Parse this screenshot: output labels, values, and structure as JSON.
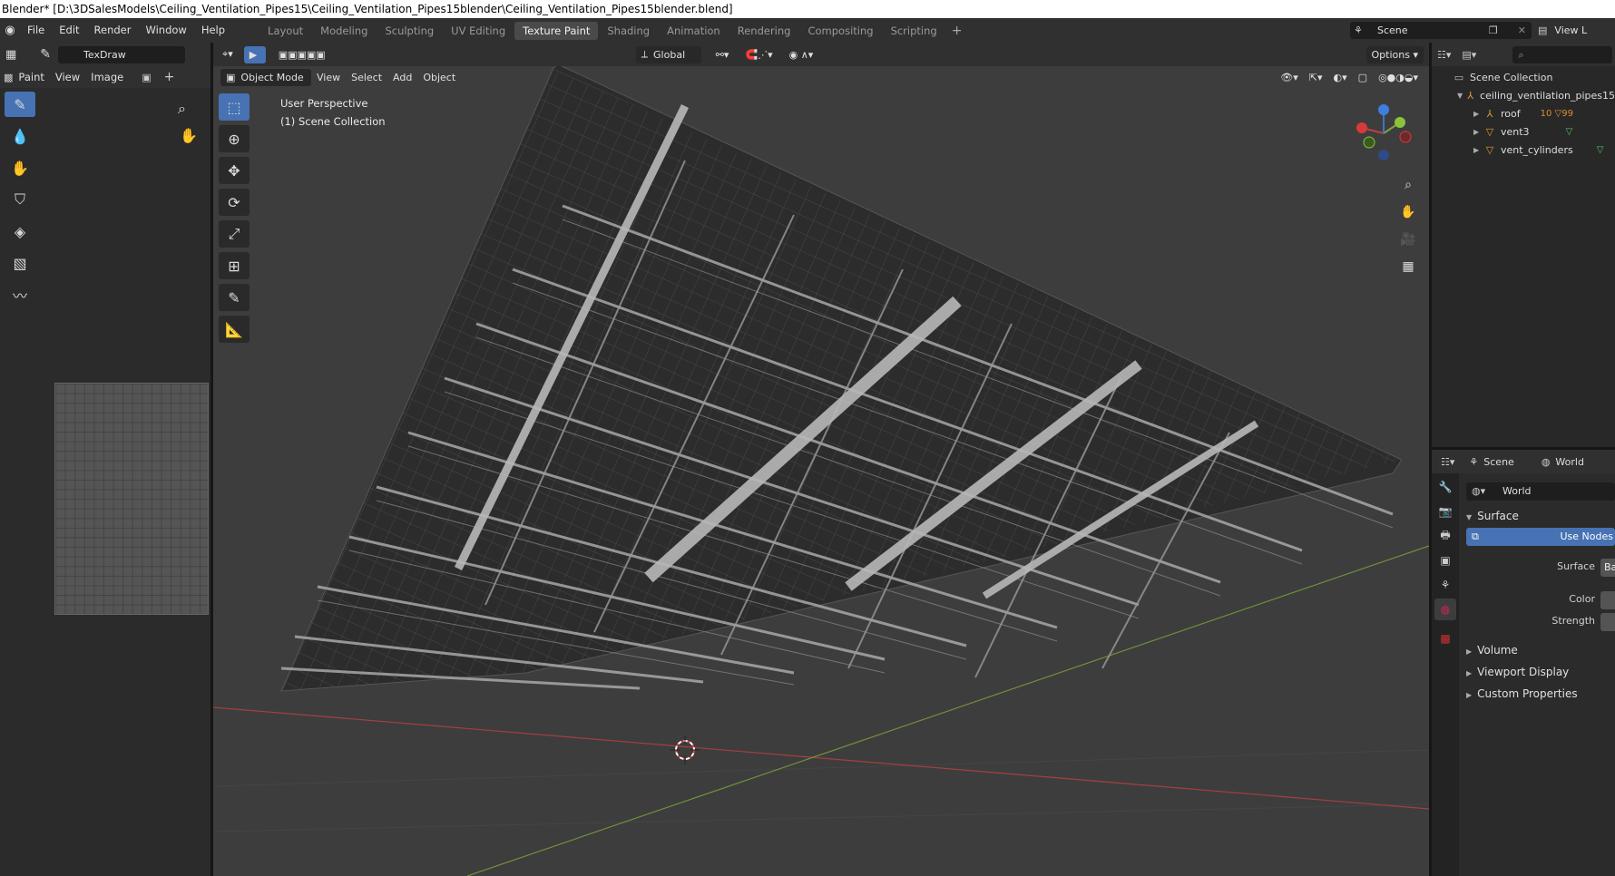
{
  "window": {
    "title": "Blender* [D:\\3DSalesModels\\Ceiling_Ventilation_Pipes15\\Ceiling_Ventilation_Pipes15blender\\Ceiling_Ventilation_Pipes15blender.blend]"
  },
  "menu": [
    "File",
    "Edit",
    "Render",
    "Window",
    "Help"
  ],
  "workspaces": {
    "tabs": [
      "Layout",
      "Modeling",
      "Sculpting",
      "UV Editing",
      "Texture Paint",
      "Shading",
      "Animation",
      "Rendering",
      "Compositing",
      "Scripting"
    ],
    "active": "Texture Paint",
    "add_label": "+"
  },
  "scene_selector": {
    "value": "Scene"
  },
  "view_layer": {
    "value": "View L"
  },
  "image_editor": {
    "brush_name": "TexDraw",
    "mode_label": "Paint",
    "view_menu": "View",
    "image_menu": "Image"
  },
  "viewport": {
    "mode_label": "Object Mode",
    "menus": [
      "View",
      "Select",
      "Add",
      "Object"
    ],
    "transform_orientation": "Global",
    "options_label": "Options",
    "overlay_line1": "User Perspective",
    "overlay_line2": "(1) Scene Collection"
  },
  "outliner": {
    "search_placeholder": "",
    "root": "Scene Collection",
    "collection": "ceiling_ventilation_pipes15",
    "objects": [
      {
        "name": "roof",
        "extra": "10 ▽99"
      },
      {
        "name": "vent3",
        "extra": "▽"
      },
      {
        "name": "vent_cylinders",
        "extra": "▽"
      }
    ]
  },
  "properties": {
    "header_scene": "Scene",
    "header_world": "World",
    "world_field": "World",
    "surface_panel": "Surface",
    "use_nodes_label": "Use Nodes",
    "surface_label": "Surface",
    "surface_value": "Ba",
    "color_label": "Color",
    "strength_label": "Strength",
    "volume_panel": "Volume",
    "viewport_display_panel": "Viewport Display",
    "custom_properties_panel": "Custom Properties"
  },
  "colors": {
    "accent": "#4772b3",
    "x_axis": "#c0403f",
    "y_axis": "#7ea43a",
    "viewport_bg": "#3d3d3d"
  }
}
